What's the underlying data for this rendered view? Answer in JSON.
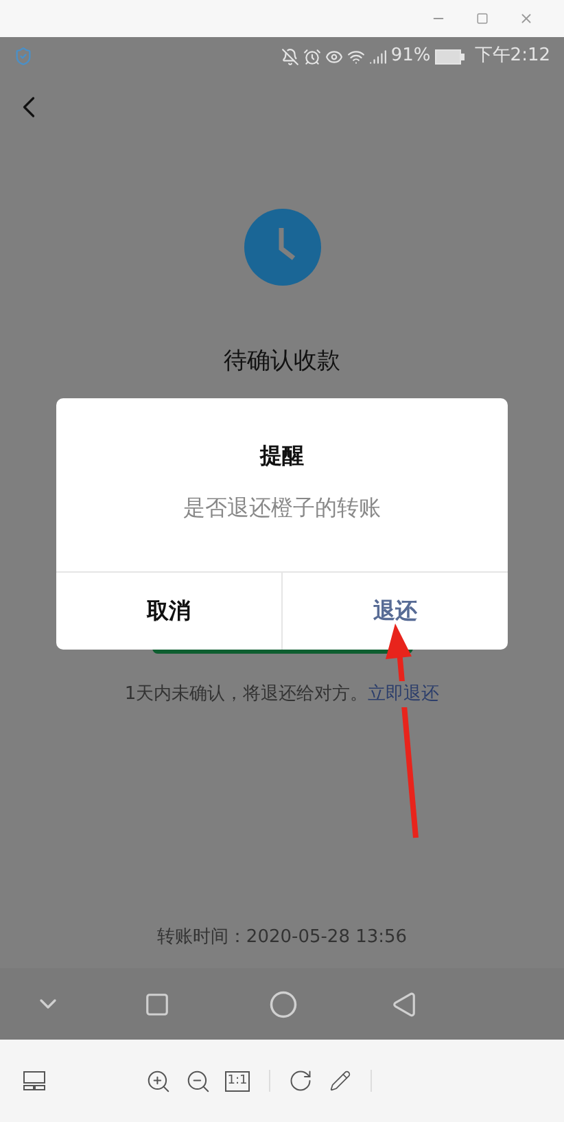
{
  "status_bar": {
    "battery": "91%",
    "time": "下午2:12"
  },
  "page": {
    "title": "待确认收款",
    "notice": "1天内未确认，将退还给对方。",
    "notice_link": "立即退还",
    "transfer_time": "转账时间：2020-05-28 13:56"
  },
  "dialog": {
    "title": "提醒",
    "message": "是否退还橙子的转账",
    "buttons": [
      {
        "label": "取消",
        "kind": "cancel"
      },
      {
        "label": "退还",
        "kind": "confirm"
      }
    ]
  },
  "toolbar": {
    "actual_size": "1:1"
  }
}
